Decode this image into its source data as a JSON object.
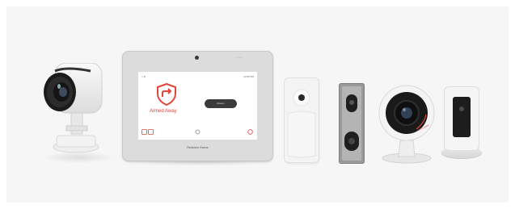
{
  "panel": {
    "status_left": "□ ★",
    "status_right": "12:05 PM",
    "top_small": "— □ □",
    "armed_label": "Armed Away",
    "disarm_label": "Disarm",
    "brand": "Resideo Home"
  },
  "round_camera": {
    "brand": "Honeywell"
  },
  "colors": {
    "accent": "#e0453a",
    "background": "#f6f6f6"
  }
}
